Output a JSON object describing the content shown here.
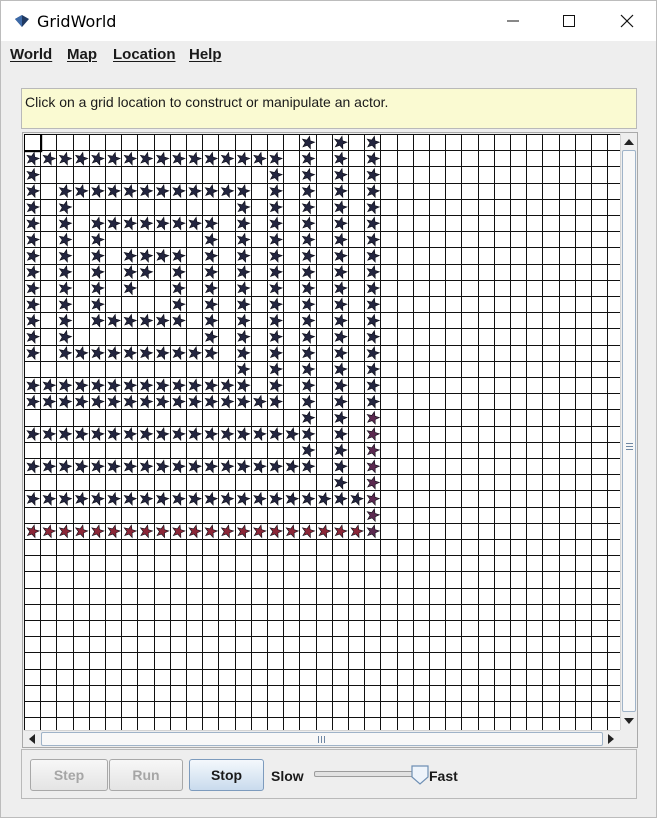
{
  "window": {
    "title": "GridWorld",
    "controls": [
      "minimize-icon",
      "maximize-icon",
      "close-icon"
    ]
  },
  "menu": {
    "items": [
      "World",
      "Map",
      "Location",
      "Help"
    ]
  },
  "message": "Click on a grid location to construct or manipulate an actor.",
  "grid": {
    "visible_cols": 37,
    "visible_rows": 37,
    "actor_icon": "bug-star-icon",
    "actor_color_default": "#23253f",
    "actor_color_red": "#8a2637",
    "actor_color_purple": "#5b2950",
    "selected_cell": {
      "row": 0,
      "col": 0
    }
  },
  "controls": {
    "step_label": "Step",
    "run_label": "Run",
    "stop_label": "Stop",
    "slow_label": "Slow",
    "fast_label": "Fast",
    "speed_fraction": 0.92
  }
}
